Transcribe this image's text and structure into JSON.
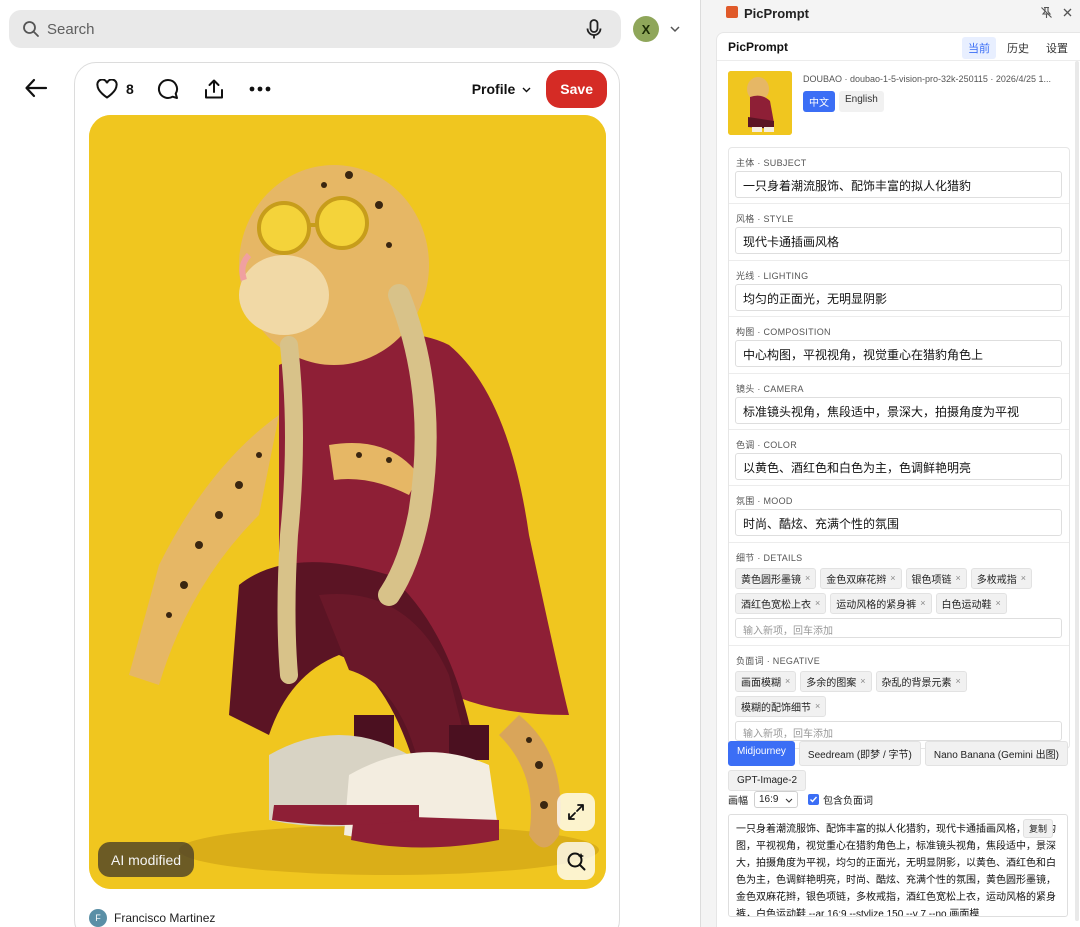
{
  "search": {
    "placeholder": "Search"
  },
  "account": {
    "initial": "X"
  },
  "pin": {
    "likes": "8",
    "profile_label": "Profile",
    "save_label": "Save",
    "ai_badge": "AI modified",
    "author_name": "Francisco Martinez",
    "author_initial": "F"
  },
  "panel": {
    "window_title": "PicPrompt",
    "brand": "PicPrompt",
    "tabs": [
      {
        "label": "当前",
        "active": true
      },
      {
        "label": "历史",
        "active": false
      },
      {
        "label": "设置",
        "active": false
      }
    ],
    "meta_line": "DOUBAO · doubao-1-5-vision-pro-32k-250115 · 2026/4/25 1...",
    "langs": [
      {
        "label": "中文",
        "active": true
      },
      {
        "label": "English",
        "active": false
      }
    ],
    "fields": [
      {
        "label": "主体 · SUBJECT",
        "value": "一只身着潮流服饰、配饰丰富的拟人化猎豹"
      },
      {
        "label": "风格 · STYLE",
        "value": "现代卡通插画风格"
      },
      {
        "label": "光线 · LIGHTING",
        "value": "均匀的正面光，无明显阴影"
      },
      {
        "label": "构图 · COMPOSITION",
        "value": "中心构图，平视视角，视觉重心在猎豹角色上"
      },
      {
        "label": "镜头 · CAMERA",
        "value": "标准镜头视角，焦段适中，景深大，拍摄角度为平视"
      },
      {
        "label": "色调 · COLOR",
        "value": "以黄色、酒红色和白色为主，色调鲜艳明亮"
      },
      {
        "label": "氛围 · MOOD",
        "value": "时尚、酷炫、充满个性的氛围"
      }
    ],
    "details": {
      "label": "细节 · DETAILS",
      "tags": [
        "黄色圆形墨镜",
        "金色双麻花辫",
        "银色项链",
        "多枚戒指",
        "酒红色宽松上衣",
        "运动风格的紧身裤",
        "白色运动鞋"
      ],
      "input_placeholder": "输入新项，回车添加"
    },
    "negative": {
      "label": "负面词 · NEGATIVE",
      "tags": [
        "画面模糊",
        "多余的图案",
        "杂乱的背景元素",
        "模糊的配饰细节"
      ],
      "input_placeholder": "输入新项，回车添加"
    },
    "models": [
      {
        "label": "Midjourney",
        "active": true
      },
      {
        "label": "Seedream (即梦 / 字节)",
        "active": false
      },
      {
        "label": "Nano Banana (Gemini 出图)",
        "active": false
      },
      {
        "label": "GPT-Image-2",
        "active": false
      }
    ],
    "ratio_label": "画幅",
    "ratio_value": "16:9",
    "include_negative_label": "包含负面词",
    "include_negative": true,
    "copy_label": "复制",
    "output_text": "一只身着潮流服饰、配饰丰富的拟人化猎豹，现代卡通插画风格，中心构图，平视视角，视觉重心在猎豹角色上，标准镜头视角，焦段适中，景深大，拍摄角度为平视，均匀的正面光，无明显阴影，以黄色、酒红色和白色为主，色调鲜艳明亮，时尚、酷炫、充满个性的氛围，黄色圆形墨镜，金色双麻花辫，银色项链，多枚戒指，酒红色宽松上衣，运动风格的紧身裤，白色运动鞋 --ar 16:9 --stylize 150 --v 7 --no 画面模"
  },
  "colors": {
    "save": "#d52b25",
    "accent": "#3b6ef5",
    "image_bg": "#f0c61f",
    "shirt": "#8e1f36"
  }
}
